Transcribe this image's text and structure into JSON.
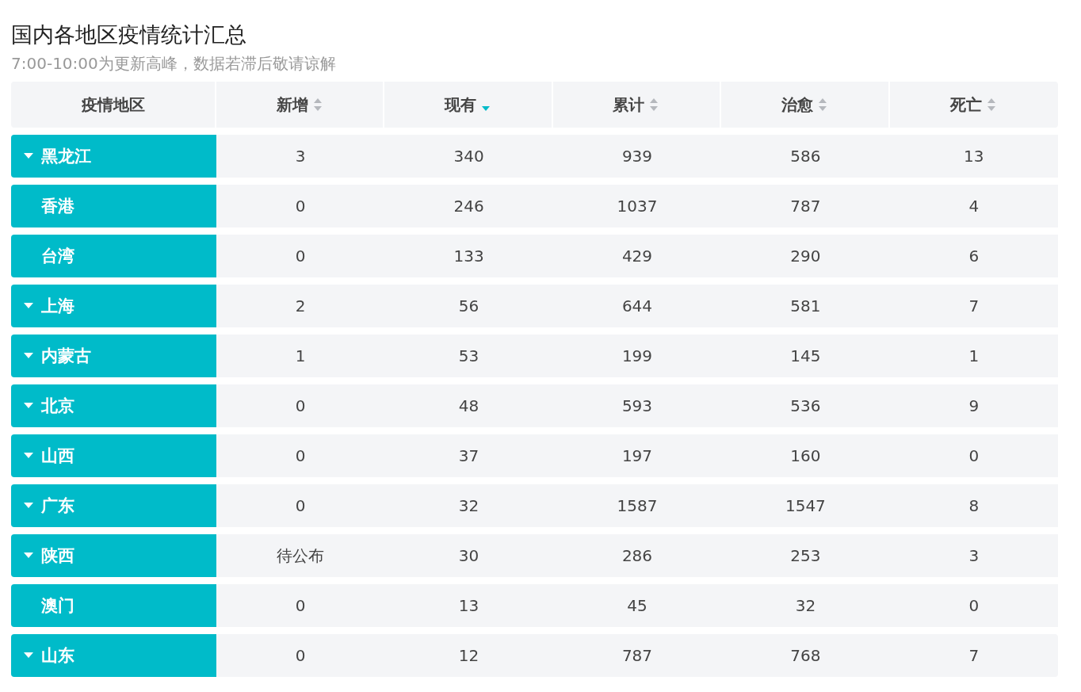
{
  "title": "国内各地区疫情统计汇总",
  "subtitle": "7:00-10:00为更新高峰，数据若滞后敬请谅解",
  "table": {
    "columns": [
      {
        "label": "疫情地区",
        "sortable": false
      },
      {
        "label": "新增",
        "sortable": true,
        "sorted": false
      },
      {
        "label": "现有",
        "sortable": true,
        "sorted": true
      },
      {
        "label": "累计",
        "sortable": true,
        "sorted": false
      },
      {
        "label": "治愈",
        "sortable": true,
        "sorted": false
      },
      {
        "label": "死亡",
        "sortable": true,
        "sorted": false
      }
    ],
    "rows": [
      {
        "expandable": true,
        "cells": [
          "黑龙江",
          "3",
          "340",
          "939",
          "586",
          "13"
        ]
      },
      {
        "expandable": false,
        "cells": [
          "香港",
          "0",
          "246",
          "1037",
          "787",
          "4"
        ]
      },
      {
        "expandable": false,
        "cells": [
          "台湾",
          "0",
          "133",
          "429",
          "290",
          "6"
        ]
      },
      {
        "expandable": true,
        "cells": [
          "上海",
          "2",
          "56",
          "644",
          "581",
          "7"
        ]
      },
      {
        "expandable": true,
        "cells": [
          "内蒙古",
          "1",
          "53",
          "199",
          "145",
          "1"
        ]
      },
      {
        "expandable": true,
        "cells": [
          "北京",
          "0",
          "48",
          "593",
          "536",
          "9"
        ]
      },
      {
        "expandable": true,
        "cells": [
          "山西",
          "0",
          "37",
          "197",
          "160",
          "0"
        ]
      },
      {
        "expandable": true,
        "cells": [
          "广东",
          "0",
          "32",
          "1587",
          "1547",
          "8"
        ]
      },
      {
        "expandable": true,
        "cells": [
          "陕西",
          "待公布",
          "30",
          "286",
          "253",
          "3"
        ]
      },
      {
        "expandable": false,
        "cells": [
          "澳门",
          "0",
          "13",
          "45",
          "32",
          "0"
        ]
      },
      {
        "expandable": true,
        "cells": [
          "山东",
          "0",
          "12",
          "787",
          "768",
          "7"
        ]
      }
    ]
  }
}
